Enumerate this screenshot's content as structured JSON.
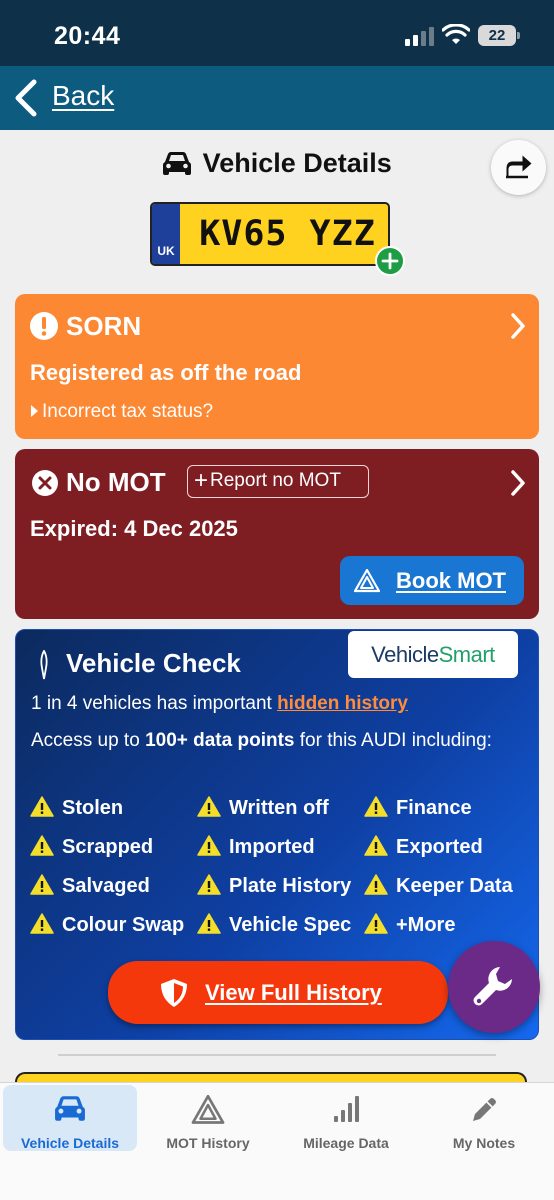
{
  "status_bar": {
    "time": "20:44",
    "battery": "22"
  },
  "nav": {
    "back_label": "Back"
  },
  "header": {
    "title": "Vehicle Details"
  },
  "plate": {
    "country": "UK",
    "registration": "KV65 YZZ"
  },
  "sorn_card": {
    "title": "SORN",
    "subtitle": "Registered as off the road",
    "link": "Incorrect tax status?"
  },
  "mot_card": {
    "title": "No MOT",
    "report_button": "Report no MOT",
    "expired": "Expired: 4 Dec 2025",
    "book_button": "Book MOT"
  },
  "vehicle_check": {
    "title": "Vehicle Check",
    "brand_a": "Vehicle",
    "brand_b": "Smart",
    "line1_prefix": "1 in 4 vehicles has important",
    "line1_link": "hidden history",
    "line2_prefix": "Access up to",
    "line2_bold": "100+ data points",
    "line2_suffix": "for this AUDI including:",
    "features": [
      "Stolen",
      "Written off",
      "Finance",
      "Scrapped",
      "Imported",
      "Exported",
      "Salvaged",
      "Plate History",
      "Keeper Data",
      "Colour Swap",
      "Vehicle Spec",
      "+More"
    ],
    "view_button": "View Full History"
  },
  "tabs": [
    {
      "label": "Vehicle Details",
      "active": true
    },
    {
      "label": "MOT History",
      "active": false
    },
    {
      "label": "Mileage Data",
      "active": false
    },
    {
      "label": "My Notes",
      "active": false
    }
  ],
  "colors": {
    "sorn": "#fd8834",
    "mot": "#7f1e22",
    "accent_blue": "#1976d2",
    "cta_red": "#f5380c",
    "fab_purple": "#6b2a87",
    "warning_yellow": "#f3df2b"
  },
  "icons": {
    "back": "chevron-left-icon",
    "title": "car-icon",
    "share": "share-icon",
    "sorn": "exclamation-circle-icon",
    "mot": "x-circle-icon",
    "book": "mot-triangle-icon",
    "check": "probe-icon",
    "feature": "warning-triangle-icon",
    "view": "shield-icon",
    "fab": "wrench-icon"
  }
}
